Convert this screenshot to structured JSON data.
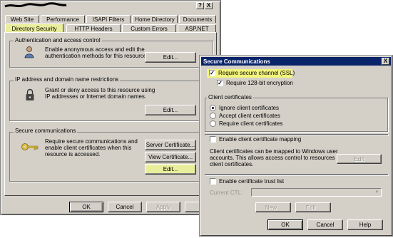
{
  "main_dialog": {
    "title_bar_buttons": [
      "?",
      "X"
    ],
    "tabs_row1": [
      "Web Site",
      "Performance",
      "ISAPI Filters",
      "Home Directory",
      "Documents"
    ],
    "tabs_row2": [
      "Directory Security",
      "HTTP Headers",
      "Custom Errors",
      "ASP.NET"
    ],
    "auth": {
      "group_label": "Authentication and access control",
      "desc_line1": "Enable anonymous access and edit the",
      "desc_line2": "authentication methods for this resource.",
      "edit_label": "Edit..."
    },
    "ip": {
      "group_label": "IP address and domain name restrictions",
      "desc_line1": "Grant or deny access to this resource using",
      "desc_line2": "IP addresses or Internet domain names.",
      "edit_label": "Edit..."
    },
    "secure": {
      "group_label": "Secure communications",
      "desc_line1": "Require secure communications and",
      "desc_line2": "enable client certificates when this",
      "desc_line3": "resource is accessed.",
      "server_cert_label": "Server Certificate...",
      "view_cert_label": "View Certificate...",
      "edit_label": "Edit..."
    },
    "bottom_buttons": {
      "ok": "OK",
      "cancel": "Cancel",
      "apply": "Apply",
      "help": "H"
    }
  },
  "secure_dialog": {
    "title": "Secure Communications",
    "close": "X",
    "require_ssl": {
      "label": "Require secure channel (SSL)",
      "checked": true
    },
    "require_128": {
      "label": "Require 128-bit encryption",
      "checked": true
    },
    "client_certs": {
      "group_label": "Client certificates",
      "options": [
        "Ignore client certificates",
        "Accept client certificates",
        "Require client certificates"
      ],
      "selected": "Ignore client certificates"
    },
    "mapping": {
      "label": "Enable client certificate mapping",
      "desc_line1": "Client certificates can be mapped to Windows user",
      "desc_line2": "accounts.  This allows access control to resources using",
      "desc_line3": "client certificates.",
      "edit_label": "Edit"
    },
    "trust": {
      "label": "Enable certificate trust list",
      "current_ctl_label": "Current CTL:",
      "current_ctl_value": "",
      "new_label": "New...",
      "edit_label": "Edit..."
    },
    "bottom_buttons": {
      "ok": "OK",
      "cancel": "Cancel",
      "help": "Help"
    }
  },
  "colors": {
    "highlight": "#e9ee9c",
    "titlebar": "#0a246a",
    "face": "#d4d0c8"
  },
  "icons": [
    "key-icon",
    "lock-icon",
    "person-icon"
  ]
}
